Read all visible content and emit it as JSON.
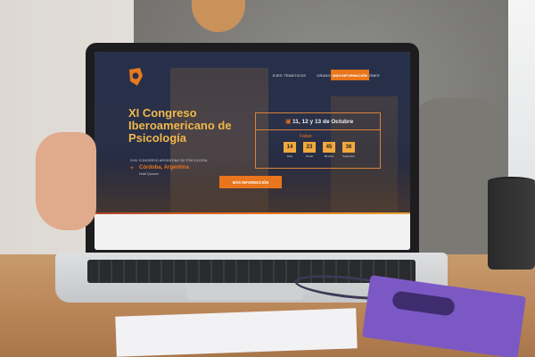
{
  "site": {
    "nav": [
      "EJES TEMÁTICOS",
      "ORADORES",
      "INSCRIPCIONES"
    ],
    "nav_cta": "MÁS INFORMACIÓN",
    "title": "XI Congreso Iberoamericano de Psicología",
    "subtitle": "XVIII CONGRESO ARGENTINO DE PSICOLOGÍA",
    "location": "Córdoba, Argentina",
    "venue": "Hotel Quorum",
    "dates": "11, 12 y 13 de Octubre",
    "countdown_label": "Faltan",
    "countdown": [
      {
        "value": "14",
        "label": "Días"
      },
      {
        "value": "23",
        "label": "Horas"
      },
      {
        "value": "45",
        "label": "Minutos"
      },
      {
        "value": "36",
        "label": "Segundos"
      }
    ],
    "cta_button": "MÁS INFORMACIÓN"
  },
  "colors": {
    "accent": "#e9751c",
    "title": "#f0b84a",
    "hero_bg": "#26304a"
  },
  "icons": {
    "logo": "psychology-logo-icon",
    "location": "location-pin-icon",
    "calendar": "calendar-icon"
  }
}
